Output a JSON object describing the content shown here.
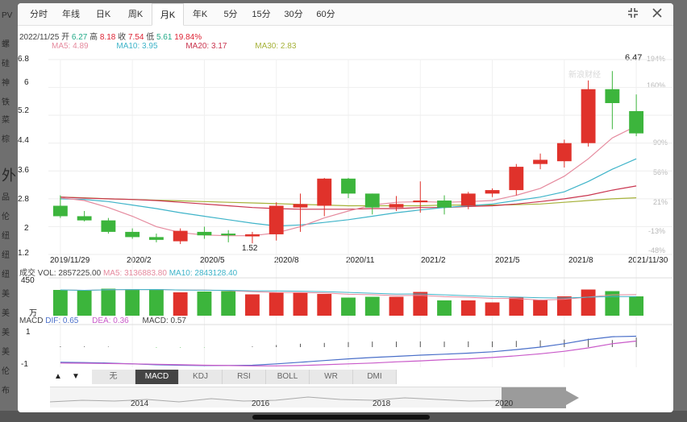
{
  "toolbar": {
    "tabs": [
      "分时",
      "年线",
      "日K",
      "周K",
      "月K",
      "年K",
      "5分",
      "15分",
      "30分",
      "60分"
    ],
    "active_tab": "月K"
  },
  "info": {
    "date": "2022/11/25",
    "open_label": "开",
    "open": "6.27",
    "high_label": "高",
    "high": "8.18",
    "close_label": "收",
    "close": "7.54",
    "low_label": "低",
    "low": "5.61",
    "change": "19.84%"
  },
  "ma_legend": [
    {
      "text": "MA5: 4.89",
      "color": "#e58a9e"
    },
    {
      "text": "MA10: 3.95",
      "color": "#3fb4c9"
    },
    {
      "text": "MA20: 3.17",
      "color": "#c9354f"
    },
    {
      "text": "MA30: 2.83",
      "color": "#a6b23a"
    }
  ],
  "left_axis": [
    "6.8",
    "6",
    "5.2",
    "4.4",
    "3.6",
    "2.8",
    "2",
    "1.2"
  ],
  "right_axis": [
    "194%",
    "160%",
    "90%",
    "56%",
    "21%",
    "-13%",
    "-48%"
  ],
  "x_axis": [
    "2019/11/29",
    "2020/2",
    "2020/5",
    "2020/8",
    "2020/11",
    "2021/2",
    "2021/5",
    "2021/8",
    "2021/11/30"
  ],
  "annotations": {
    "high": "6.47",
    "low": "1.52"
  },
  "watermark": "新浪财经",
  "volume": {
    "label": "成交",
    "vol": "VOL: 2857225.00",
    "ma5": "MA5: 3136883.80",
    "ma10": "MA10: 2843128.40",
    "axis_top": "450",
    "unit": "万"
  },
  "macd": {
    "label": "MACD",
    "dif": "DIF: 0.65",
    "dea": "DEA: 0.36",
    "macd": "MACD: 0.57",
    "axis_top": "1",
    "axis_bottom": "-1"
  },
  "indicator_tabs": [
    "无",
    "MACD",
    "KDJ",
    "RSI",
    "BOLL",
    "WR",
    "DMI"
  ],
  "active_indicator": "MACD",
  "range_years": [
    "2014",
    "2016",
    "2018",
    "2020"
  ],
  "colors": {
    "up": "#e0322b",
    "down": "#3cb53c",
    "active_tab_bg": "#444444"
  },
  "chart_data": {
    "type": "candlestick",
    "title": "",
    "ylim": [
      1.2,
      6.8
    ],
    "categories": [
      "2019/11",
      "2019/12",
      "2020/1",
      "2020/2",
      "2020/3",
      "2020/4",
      "2020/5",
      "2020/6",
      "2020/7",
      "2020/8",
      "2020/9",
      "2020/10",
      "2020/11",
      "2020/12",
      "2021/1",
      "2021/2",
      "2021/3",
      "2021/4",
      "2021/5",
      "2021/6",
      "2021/7",
      "2021/8",
      "2021/9",
      "2021/10",
      "2021/11"
    ],
    "ohlc": [
      [
        2.6,
        2.9,
        2.25,
        2.3
      ],
      [
        2.3,
        2.45,
        2.15,
        2.18
      ],
      [
        2.18,
        2.25,
        1.8,
        1.85
      ],
      [
        1.85,
        1.95,
        1.65,
        1.7
      ],
      [
        1.7,
        1.8,
        1.55,
        1.62
      ],
      [
        1.58,
        1.95,
        1.5,
        1.88
      ],
      [
        1.85,
        2.0,
        1.65,
        1.75
      ],
      [
        1.8,
        1.9,
        1.55,
        1.75
      ],
      [
        1.72,
        1.85,
        1.52,
        1.78
      ],
      [
        1.78,
        2.7,
        1.6,
        2.6
      ],
      [
        2.55,
        2.95,
        1.85,
        2.65
      ],
      [
        2.6,
        3.4,
        2.3,
        3.38
      ],
      [
        3.38,
        3.4,
        2.82,
        2.95
      ],
      [
        2.95,
        2.95,
        2.35,
        2.55
      ],
      [
        2.55,
        2.88,
        2.45,
        2.65
      ],
      [
        2.7,
        3.3,
        2.4,
        2.75
      ],
      [
        2.75,
        2.9,
        2.35,
        2.55
      ],
      [
        2.6,
        3.0,
        2.5,
        2.95
      ],
      [
        2.95,
        3.1,
        2.85,
        3.05
      ],
      [
        3.05,
        3.8,
        2.9,
        3.72
      ],
      [
        3.8,
        4.1,
        3.65,
        3.92
      ],
      [
        3.88,
        4.5,
        3.7,
        4.4
      ],
      [
        4.4,
        6.2,
        4.3,
        5.95
      ],
      [
        5.95,
        6.47,
        4.8,
        5.55
      ],
      [
        5.32,
        5.8,
        4.6,
        4.68
      ]
    ],
    "ma5": [
      2.83,
      2.75,
      2.55,
      2.3,
      2.0,
      1.83,
      1.76,
      1.74,
      1.74,
      1.82,
      2.0,
      2.25,
      2.45,
      2.62,
      2.7,
      2.72,
      2.7,
      2.72,
      2.75,
      2.9,
      3.1,
      3.45,
      3.95,
      4.55,
      4.89
    ],
    "ma10": [
      2.8,
      2.78,
      2.72,
      2.62,
      2.52,
      2.4,
      2.3,
      2.2,
      2.1,
      2.02,
      2.05,
      2.12,
      2.2,
      2.3,
      2.4,
      2.48,
      2.55,
      2.6,
      2.65,
      2.75,
      2.85,
      3.0,
      3.3,
      3.65,
      3.95
    ],
    "ma20": [
      2.85,
      2.82,
      2.8,
      2.78,
      2.75,
      2.7,
      2.65,
      2.6,
      2.55,
      2.52,
      2.5,
      2.5,
      2.5,
      2.52,
      2.52,
      2.55,
      2.55,
      2.58,
      2.6,
      2.65,
      2.72,
      2.8,
      2.9,
      3.05,
      3.17
    ],
    "ma30": [
      2.85,
      2.83,
      2.8,
      2.78,
      2.76,
      2.74,
      2.72,
      2.7,
      2.68,
      2.66,
      2.64,
      2.62,
      2.6,
      2.6,
      2.6,
      2.6,
      2.62,
      2.62,
      2.62,
      2.63,
      2.65,
      2.7,
      2.75,
      2.8,
      2.83
    ],
    "volume_values": [
      320,
      310,
      335,
      330,
      330,
      290,
      300,
      305,
      265,
      285,
      285,
      270,
      225,
      235,
      235,
      295,
      190,
      190,
      165,
      225,
      200,
      240,
      325,
      305,
      240
    ],
    "volume_ylim": [
      0,
      450
    ],
    "macd_dif": [
      -0.9,
      -0.92,
      -0.95,
      -1.0,
      -1.05,
      -1.08,
      -1.1,
      -1.1,
      -1.08,
      -1.0,
      -0.9,
      -0.8,
      -0.7,
      -0.62,
      -0.55,
      -0.48,
      -0.42,
      -0.36,
      -0.28,
      -0.15,
      0.0,
      0.2,
      0.45,
      0.62,
      0.65
    ],
    "macd_dea": [
      -0.95,
      -0.96,
      -0.98,
      -1.0,
      -1.02,
      -1.05,
      -1.08,
      -1.1,
      -1.12,
      -1.12,
      -1.1,
      -1.05,
      -1.0,
      -0.95,
      -0.88,
      -0.82,
      -0.75,
      -0.7,
      -0.62,
      -0.52,
      -0.4,
      -0.25,
      -0.05,
      0.2,
      0.36
    ],
    "macd_hist": [
      0.05,
      0.04,
      0.03,
      0.0,
      -0.03,
      -0.03,
      -0.02,
      0.0,
      0.04,
      0.12,
      0.2,
      0.25,
      0.3,
      0.33,
      0.33,
      0.34,
      0.33,
      0.34,
      0.34,
      0.37,
      0.4,
      0.45,
      0.5,
      0.42,
      0.57
    ],
    "macd_ylim": [
      -1.2,
      1.2
    ]
  }
}
